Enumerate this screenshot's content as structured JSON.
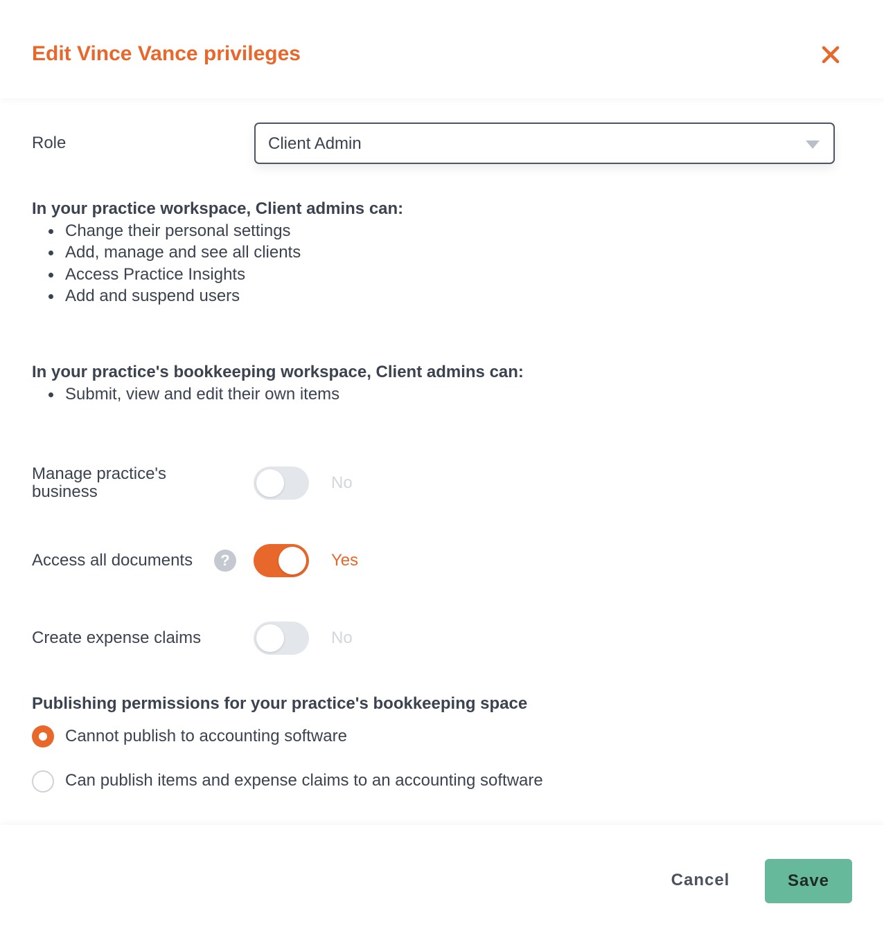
{
  "dialog": {
    "title": "Edit Vince Vance privileges",
    "close_icon": "close-icon",
    "accent_color": "#e8672a",
    "save_color": "#66b99a"
  },
  "role": {
    "label": "Role",
    "selected": "Client Admin"
  },
  "practice_workspace": {
    "heading": "In your practice workspace, Client admins can:",
    "items": [
      "Change their personal settings",
      "Add, manage and see all clients",
      "Access Practice Insights",
      "Add and suspend users"
    ]
  },
  "bookkeeping_workspace": {
    "heading": "In your practice's bookkeeping workspace, Client admins can:",
    "items": [
      "Submit, view and edit their own items"
    ]
  },
  "toggles": [
    {
      "label_line1": "Manage practice's",
      "label_line2": "business",
      "state": "No",
      "on": false
    },
    {
      "label": "Access all documents",
      "help_icon": "question-mark-icon",
      "state": "Yes",
      "on": true
    },
    {
      "label": "Create expense claims",
      "state": "No",
      "on": false
    }
  ],
  "publishing": {
    "heading": "Publishing permissions for your practice's bookkeeping space",
    "options": [
      {
        "label": "Cannot publish to accounting software",
        "checked": true
      },
      {
        "label": "Can publish items and expense claims to an accounting software",
        "checked": false
      }
    ]
  },
  "footer": {
    "cancel_label": "Cancel",
    "save_label": "Save"
  }
}
